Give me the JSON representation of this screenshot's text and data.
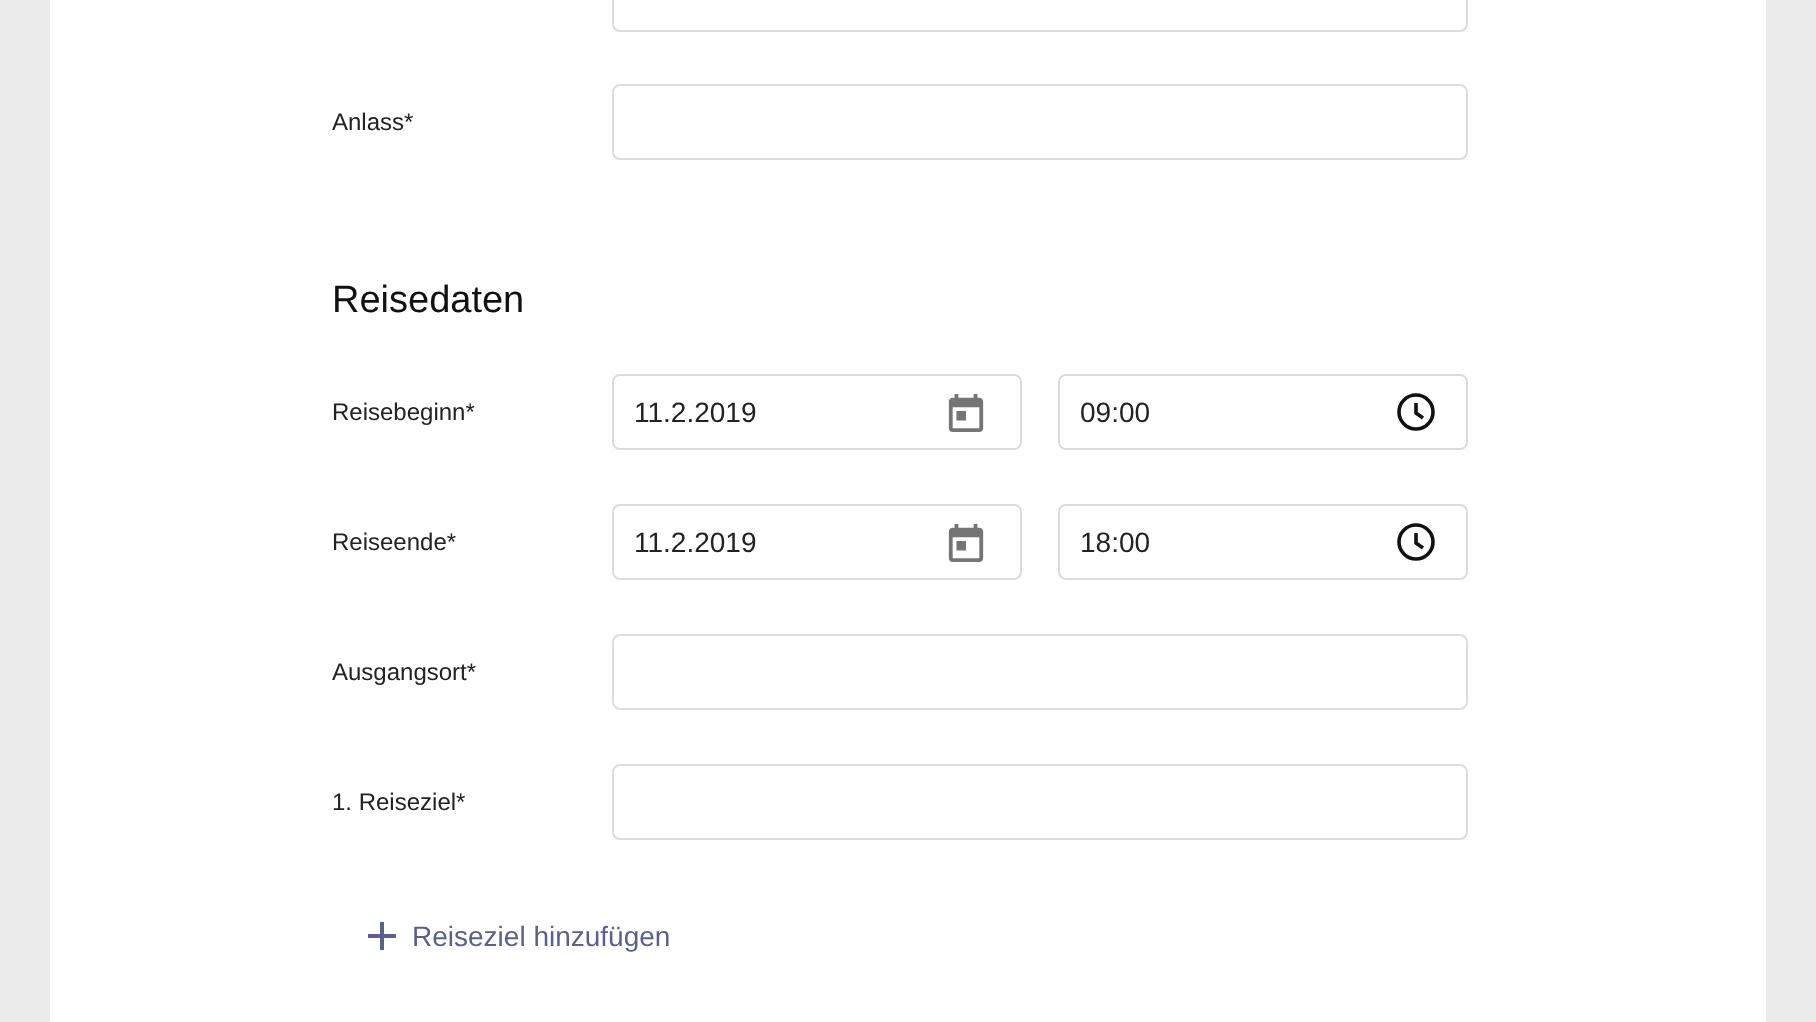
{
  "fields_before": [
    {
      "kind": "text",
      "label": "Anlass*"
    }
  ],
  "section": {
    "title": "Reisedaten"
  },
  "fields": [
    {
      "kind": "datetime",
      "label": "Reisebeginn*",
      "date": "11.2.2019",
      "time": "09:00"
    },
    {
      "kind": "datetime",
      "label": "Reiseende*",
      "date": "11.2.2019",
      "time": "18:00"
    },
    {
      "kind": "text",
      "label": "Ausgangsort*"
    },
    {
      "kind": "text",
      "label": "1. Reiseziel*"
    }
  ],
  "add_button": {
    "label": "Reiseziel hinzufügen"
  }
}
